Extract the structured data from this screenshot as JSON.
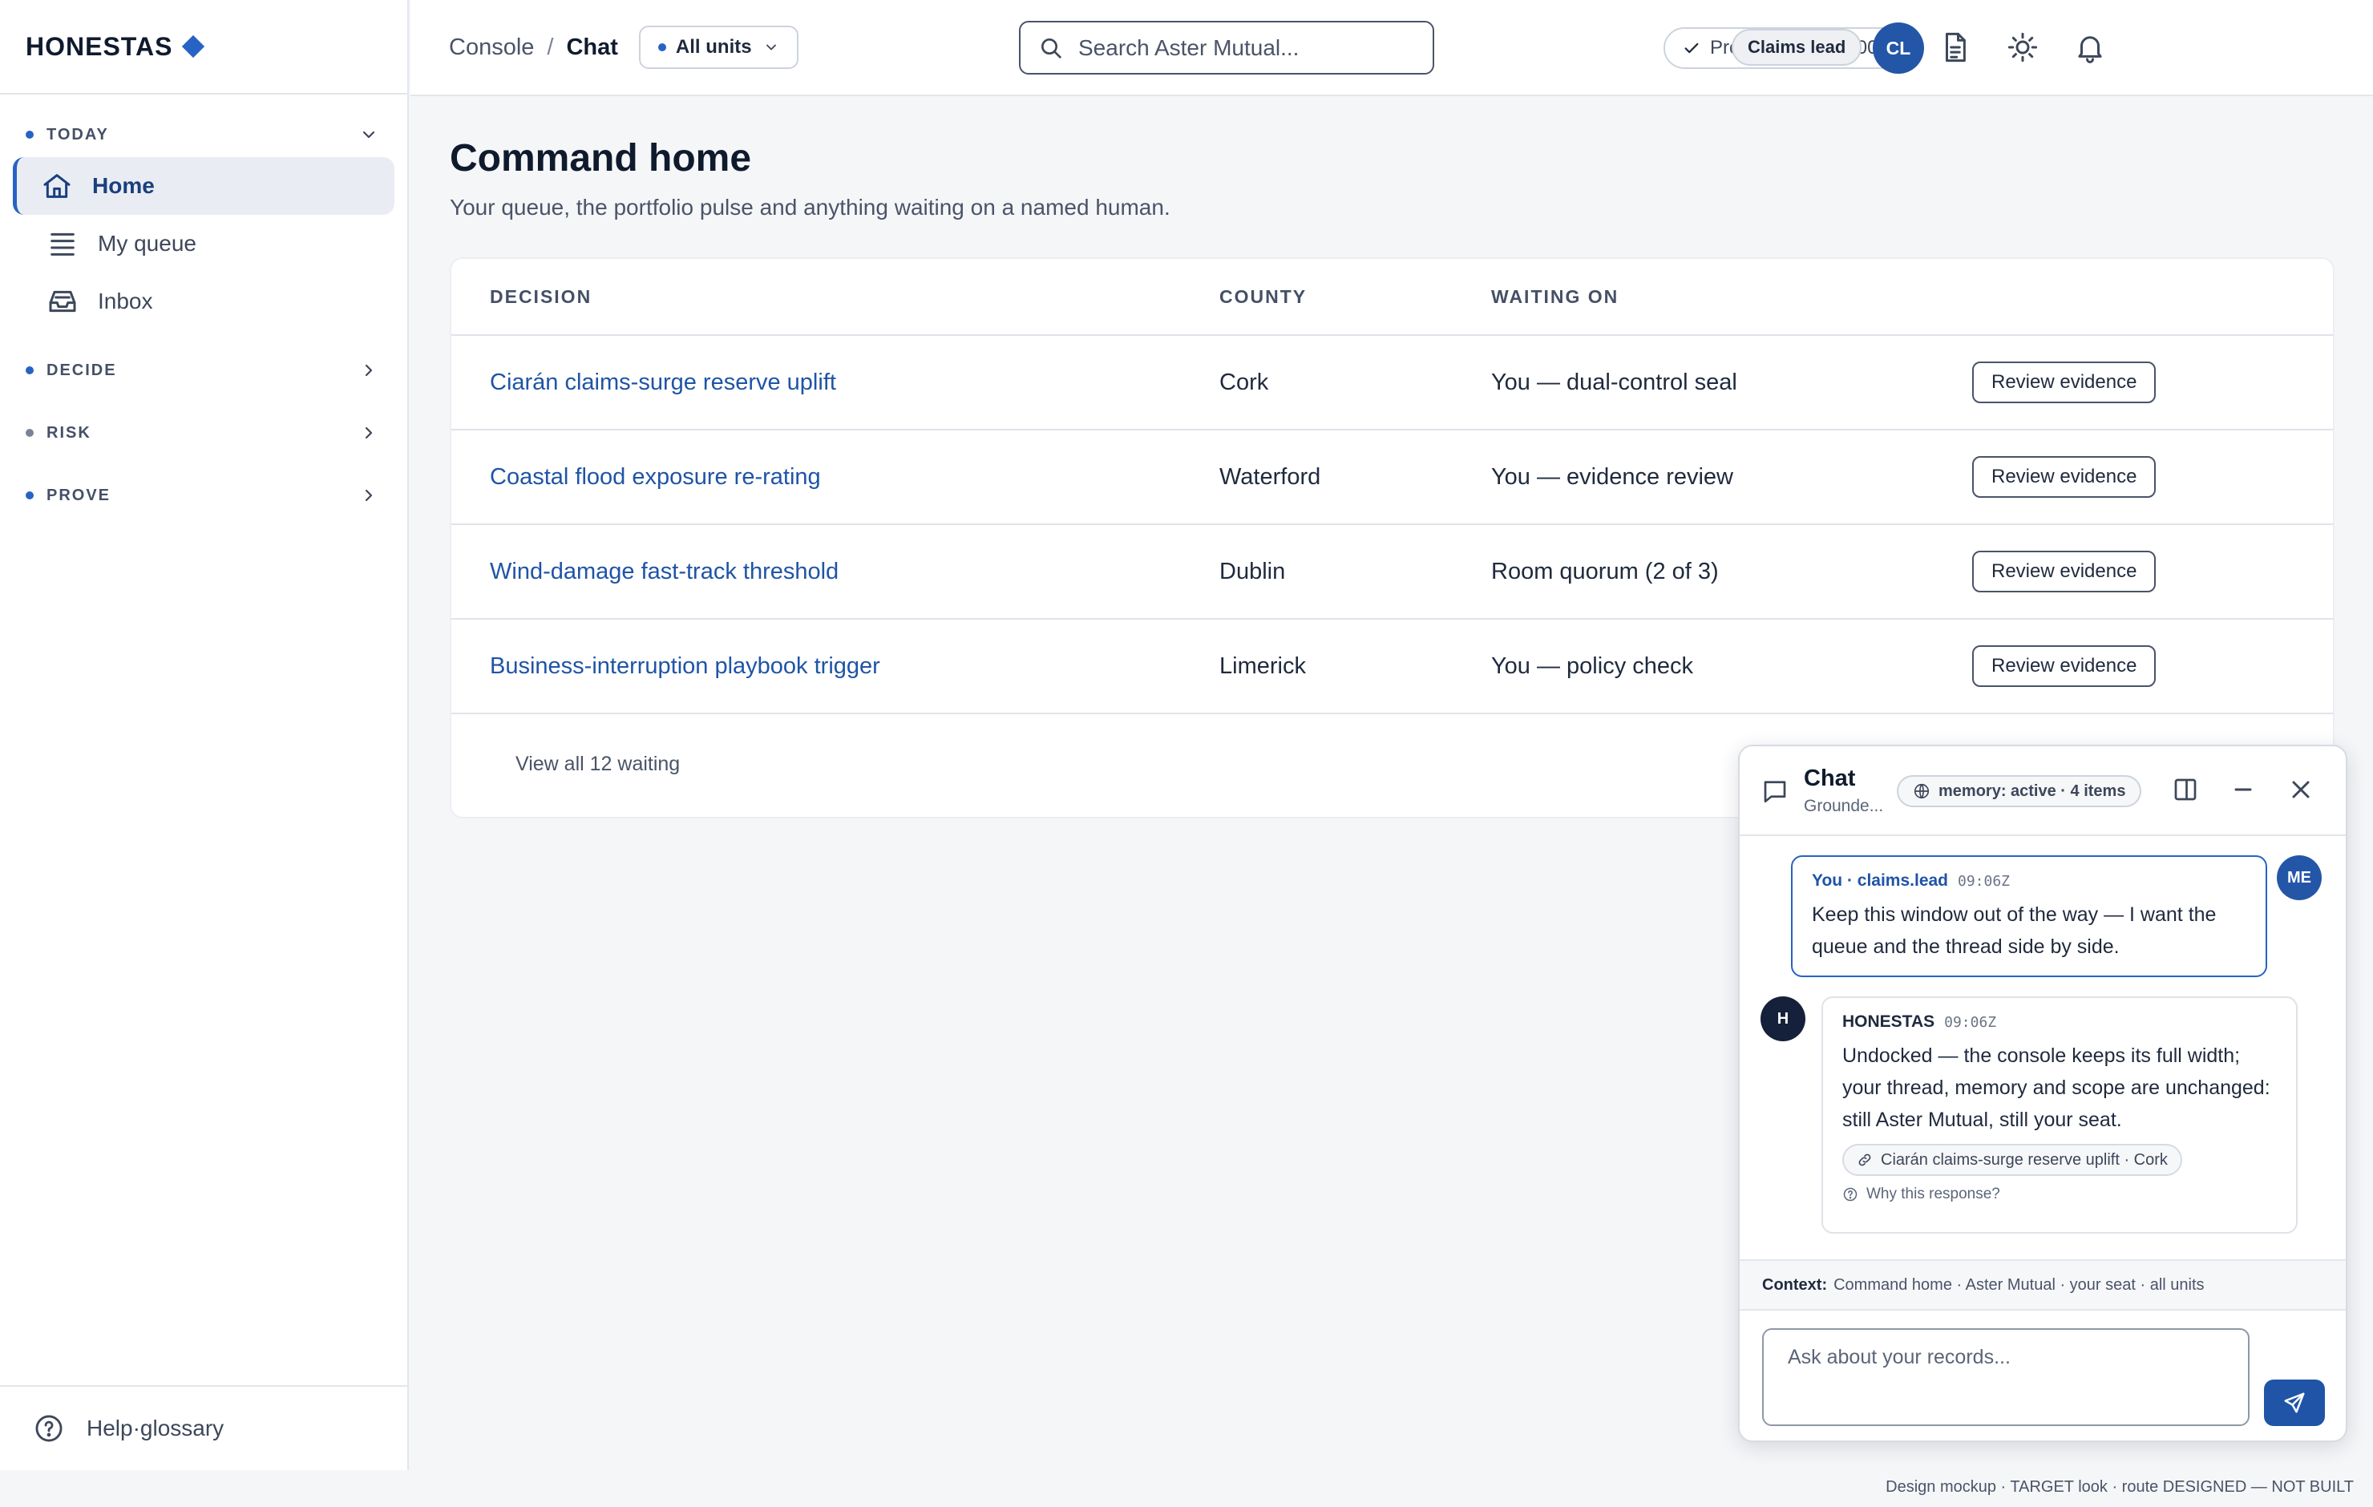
{
  "brand": {
    "name": "HONESTAS"
  },
  "nav": {
    "today_label": "TODAY",
    "items": [
      {
        "label": "Home"
      },
      {
        "label": "My queue"
      },
      {
        "label": "Inbox"
      }
    ],
    "decide_label": "DECIDE",
    "risk_label": "RISK",
    "prove_label": "PROVE",
    "help_label": "Help·glossary"
  },
  "topbar": {
    "breadcrumb_root": "Console",
    "breadcrumb_sep": "/",
    "breadcrumb_current": "Chat",
    "unit_select": "All units",
    "search_placeholder": "Search Aster Mutual...",
    "provenance": "Provenance · 09:00Z",
    "role": "Claims lead",
    "avatar_initials": "CL"
  },
  "page": {
    "title": "Command home",
    "subtitle": "Your queue, the portfolio pulse and anything waiting on a named human."
  },
  "table": {
    "headers": [
      "DECISION",
      "COUNTY",
      "WAITING ON"
    ],
    "rows": [
      {
        "decision": "Ciarán claims-surge reserve uplift",
        "county": "Cork",
        "waiting": "You — dual-control seal",
        "action": "Review evidence"
      },
      {
        "decision": "Coastal flood exposure re-rating",
        "county": "Waterford",
        "waiting": "You — evidence review",
        "action": "Review evidence"
      },
      {
        "decision": "Wind-damage fast-track threshold",
        "county": "Dublin",
        "waiting": "Room quorum (2 of 3)",
        "action": "Review evidence"
      },
      {
        "decision": "Business-interruption playbook trigger",
        "county": "Limerick",
        "waiting": "You — policy check",
        "action": "Review evidence"
      }
    ],
    "view_all": "View all 12 waiting"
  },
  "chat": {
    "title": "Chat",
    "subtitle": "Grounde...",
    "memory": "memory: active · 4 items",
    "user_msg": {
      "author": "You · claims.lead",
      "time": "09:06Z",
      "text": "Keep this window out of the way — I want the queue and the thread side by side.",
      "avatar": "ME"
    },
    "bot_msg": {
      "author": "HONESTAS",
      "time": "09:06Z",
      "text": "Undocked — the console keeps its full width; your thread, memory and scope are unchanged: still Aster Mutual, still your seat.",
      "citation": "Ciarán claims-surge reserve uplift · Cork",
      "why": "Why this response?",
      "avatar": "H"
    },
    "context_label": "Context:",
    "context_value": "Command home · Aster Mutual · your seat · all units",
    "input_placeholder": "Ask about your records..."
  },
  "footer": {
    "note": "Design mockup · TARGET look · route DESIGNED — NOT BUILT"
  },
  "colors": {
    "accent": "#2763c4",
    "link": "#1f54a6",
    "navy": "#15213a"
  }
}
